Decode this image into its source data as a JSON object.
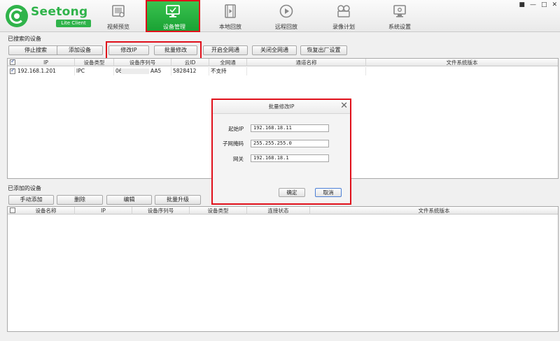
{
  "header": {
    "logo_name": "Seetong",
    "logo_sub": "Lite Client",
    "tabs": [
      {
        "label": "视频预览",
        "icon": "video-preview-icon"
      },
      {
        "label": "设备管理",
        "icon": "device-manage-icon"
      },
      {
        "label": "本地回放",
        "icon": "local-playback-icon"
      },
      {
        "label": "远程回放",
        "icon": "remote-playback-icon"
      },
      {
        "label": "录像计划",
        "icon": "record-plan-icon"
      },
      {
        "label": "系统设置",
        "icon": "system-settings-icon"
      }
    ],
    "active_tab": "设备管理",
    "window_controls": [
      "■",
      "—",
      "□",
      "✕"
    ]
  },
  "searched": {
    "label": "已搜索的设备",
    "buttons": [
      "停止搜索",
      "添加设备",
      "修改IP",
      "批量修改",
      "开启全网通",
      "关闭全网通",
      "恢复出厂设置"
    ],
    "columns": [
      "IP",
      "设备类型",
      "设备序列号",
      "云ID",
      "全网通",
      "通道名称",
      "文件系统版本"
    ],
    "rows": [
      {
        "ip": "192.168.1.201",
        "type": "IPC",
        "serial_prefix": "06",
        "serial_suffix": "AA5",
        "cloud_id": "5828412",
        "all_net": "不支持",
        "channel": "",
        "fs_version": ""
      }
    ]
  },
  "added": {
    "label": "已添加的设备",
    "buttons": [
      "手动添加",
      "删除",
      "编辑",
      "批量升级"
    ],
    "columns": [
      "设备名称",
      "IP",
      "设备序列号",
      "设备类型",
      "连接状态",
      "文件系统版本"
    ]
  },
  "dialog": {
    "title": "批量修改IP",
    "close": "✕",
    "fields": [
      {
        "label": "起始IP",
        "value": "192.168.18.11"
      },
      {
        "label": "子网掩码",
        "value": "255.255.255.0"
      },
      {
        "label": "网关",
        "value": "192.168.18.1"
      }
    ],
    "ok": "确定",
    "cancel": "取消"
  },
  "colors": {
    "brand_green": "#2fb34a",
    "highlight_red": "#e0101b"
  }
}
